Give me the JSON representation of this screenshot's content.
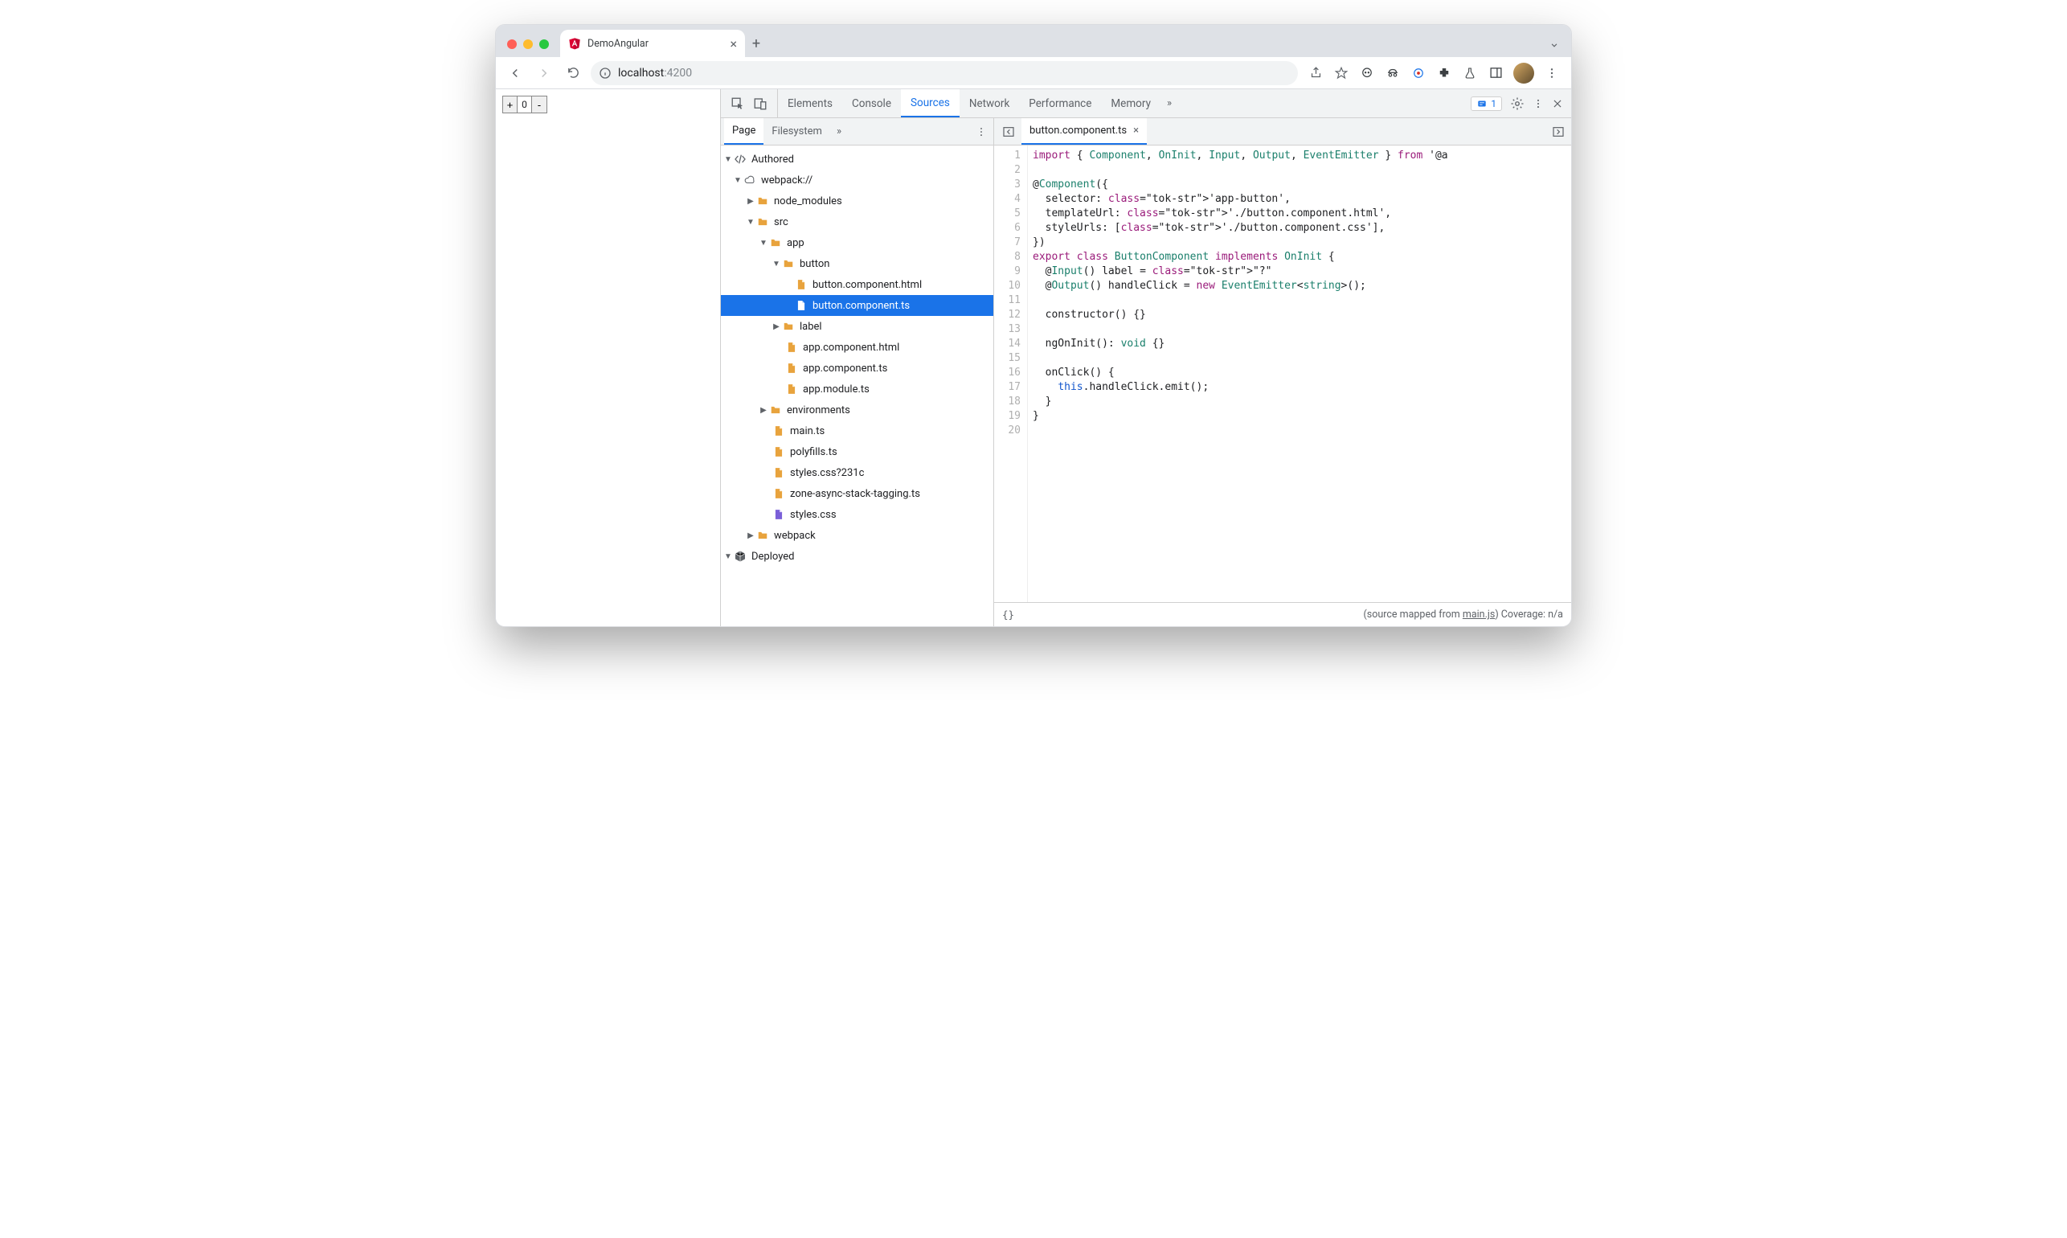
{
  "browser": {
    "tab_title": "DemoAngular",
    "url_host": "localhost",
    "url_port": ":4200"
  },
  "page": {
    "counter_value": "0",
    "plus": "+",
    "minus": "-"
  },
  "devtools": {
    "tabs": [
      "Elements",
      "Console",
      "Sources",
      "Network",
      "Performance",
      "Memory"
    ],
    "active_tab": "Sources",
    "more": "»",
    "issues_count": "1",
    "nav_tabs": [
      "Page",
      "Filesystem"
    ],
    "nav_more": "»",
    "active_nav_tab": "Page"
  },
  "tree": {
    "root": "Authored",
    "webpack": "webpack://",
    "node_modules": "node_modules",
    "src": "src",
    "app": "app",
    "button_dir": "button",
    "button_html": "button.component.html",
    "button_ts": "button.component.ts",
    "label_dir": "label",
    "app_html": "app.component.html",
    "app_ts": "app.component.ts",
    "app_module": "app.module.ts",
    "environments": "environments",
    "main_ts": "main.ts",
    "polyfills": "polyfills.ts",
    "styles_cssq": "styles.css?231c",
    "zone": "zone-async-stack-tagging.ts",
    "styles_css": "styles.css",
    "webpack_dir": "webpack",
    "deployed": "Deployed"
  },
  "editor": {
    "open_file": "button.component.ts",
    "lines": [
      "import { Component, OnInit, Input, Output, EventEmitter } from '@a",
      "",
      "@Component({",
      "  selector: 'app-button',",
      "  templateUrl: './button.component.html',",
      "  styleUrls: ['./button.component.css'],",
      "})",
      "export class ButtonComponent implements OnInit {",
      "  @Input() label = \"?\"",
      "  @Output() handleClick = new EventEmitter<string>();",
      "",
      "  constructor() {}",
      "",
      "  ngOnInit(): void {}",
      "",
      "  onClick() {",
      "    this.handleClick.emit();",
      "  }",
      "}",
      ""
    ],
    "pretty": "{}",
    "status_left": "(source mapped from ",
    "status_link": "main.js",
    "status_right_prefix": ")  Coverage: ",
    "coverage": "n/a"
  }
}
